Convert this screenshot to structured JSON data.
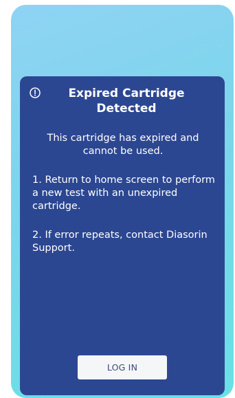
{
  "dialog": {
    "icon": "alert-circle-icon",
    "title": "Expired Cartridge Detected",
    "message": "This cartridge has expired and cannot be used.",
    "steps": [
      "1. Return to home screen to perform a new test with an unexpired cartridge.",
      "2. If error repeats, contact Diasorin Support."
    ],
    "login_label": "LOG IN"
  },
  "colors": {
    "background_gradient": [
      "#8fd3f4",
      "#69e0e6"
    ],
    "dialog_bg": "#2c4791",
    "button_bg": "#f5f6f8",
    "button_text": "#3b4a7a"
  }
}
